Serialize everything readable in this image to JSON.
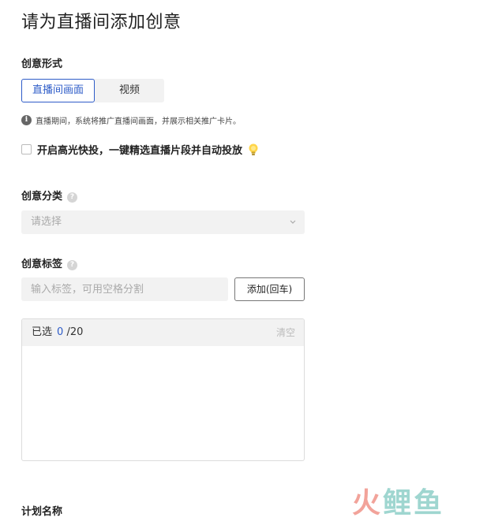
{
  "page": {
    "title": "请为直播间添加创意"
  },
  "creative_form": {
    "label": "创意形式",
    "options": [
      "直播间画面",
      "视频"
    ],
    "selected": "直播间画面",
    "hint": "直播期间，系统将推广直播间画面，并展示相关推广卡片。"
  },
  "highlight": {
    "checked": false,
    "label": "开启高光快投，一键精选直播片段并自动投放"
  },
  "category": {
    "label": "创意分类",
    "placeholder": "请选择"
  },
  "tags": {
    "label": "创意标签",
    "input_placeholder": "输入标签，可用空格分割",
    "add_button": "添加(回车)",
    "selected_label": "已选",
    "selected_count": "0",
    "max": "/20",
    "clear_label": "清空"
  },
  "plan": {
    "label": "计划名称"
  },
  "watermark": {
    "part1": "火",
    "part2": "鲤鱼"
  },
  "colors": {
    "accent": "#2e5cc8",
    "field_bg": "#f2f2f2"
  },
  "icons": [
    "info-icon",
    "lightbulb-icon",
    "help-icon",
    "chevron-down-icon"
  ]
}
